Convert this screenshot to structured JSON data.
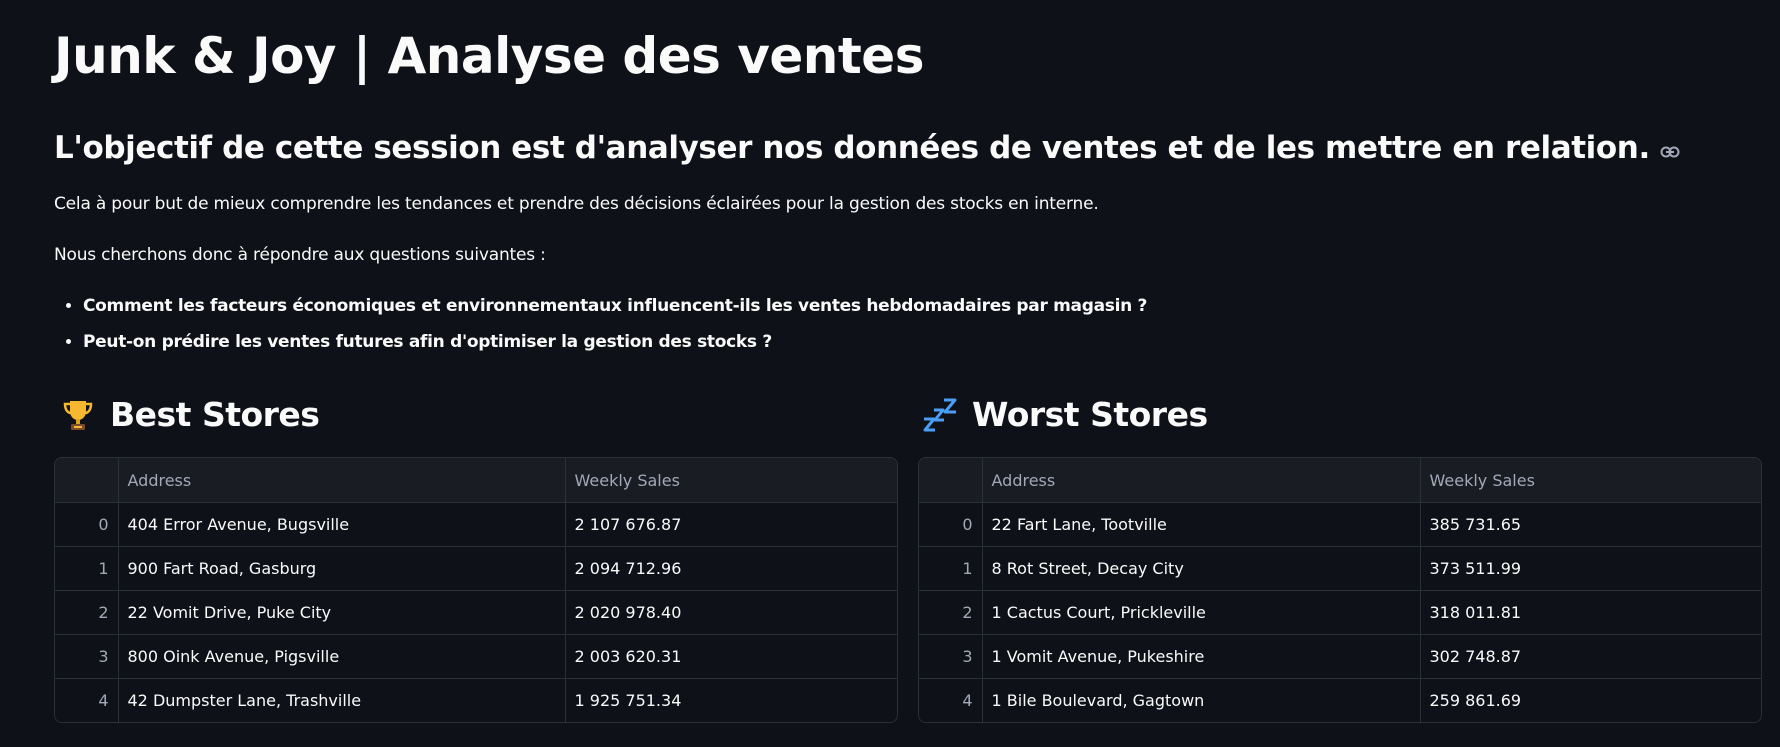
{
  "page": {
    "title": "Junk & Joy | Analyse des ventes",
    "subtitle": "L'objectif de cette session est d'analyser nos données de ventes et de les mettre en relation.",
    "paragraph1": "Cela à pour but de mieux comprendre les tendances et prendre des décisions éclairées pour la gestion des stocks en interne.",
    "paragraph2": "Nous cherchons donc à répondre aux questions suivantes :",
    "questions": [
      "Comment les facteurs économiques et environnementaux influencent-ils les ventes hebdomadaires par magasin ?",
      "Peut-on prédire les ventes futures afin d'optimiser la gestion des stocks ?"
    ]
  },
  "best": {
    "heading": "Best Stores",
    "icon": "trophy-icon",
    "columns": [
      "Address",
      "Weekly Sales"
    ],
    "rows": [
      {
        "index": "0",
        "address": "404 Error Avenue, Bugsville",
        "sales": "2 107 676.87"
      },
      {
        "index": "1",
        "address": "900 Fart Road, Gasburg",
        "sales": "2 094 712.96"
      },
      {
        "index": "2",
        "address": "22 Vomit Drive, Puke City",
        "sales": "2 020 978.40"
      },
      {
        "index": "3",
        "address": "800 Oink Avenue, Pigsville",
        "sales": "2 003 620.31"
      },
      {
        "index": "4",
        "address": "42 Dumpster Lane, Trashville",
        "sales": "1 925 751.34"
      }
    ]
  },
  "worst": {
    "heading": "Worst Stores",
    "icon": "sleeping-zzz-icon",
    "columns": [
      "Address",
      "Weekly Sales"
    ],
    "rows": [
      {
        "index": "0",
        "address": "22 Fart Lane, Tootville",
        "sales": "385 731.65"
      },
      {
        "index": "1",
        "address": "8 Rot Street, Decay City",
        "sales": "373 511.99"
      },
      {
        "index": "2",
        "address": "1 Cactus Court, Prickleville",
        "sales": "318 011.81"
      },
      {
        "index": "3",
        "address": "1 Vomit Avenue, Pukeshire",
        "sales": "302 748.87"
      },
      {
        "index": "4",
        "address": "1 Bile Boulevard, Gagtown",
        "sales": "259 861.69"
      }
    ]
  },
  "colors": {
    "background": "#0e1117",
    "text": "#fafafa",
    "muted": "#a3a8b8",
    "border": "#2c3038",
    "header_bg": "#1a1c24",
    "trophy": "#f5b82e",
    "zzz": "#4a9ef5"
  }
}
